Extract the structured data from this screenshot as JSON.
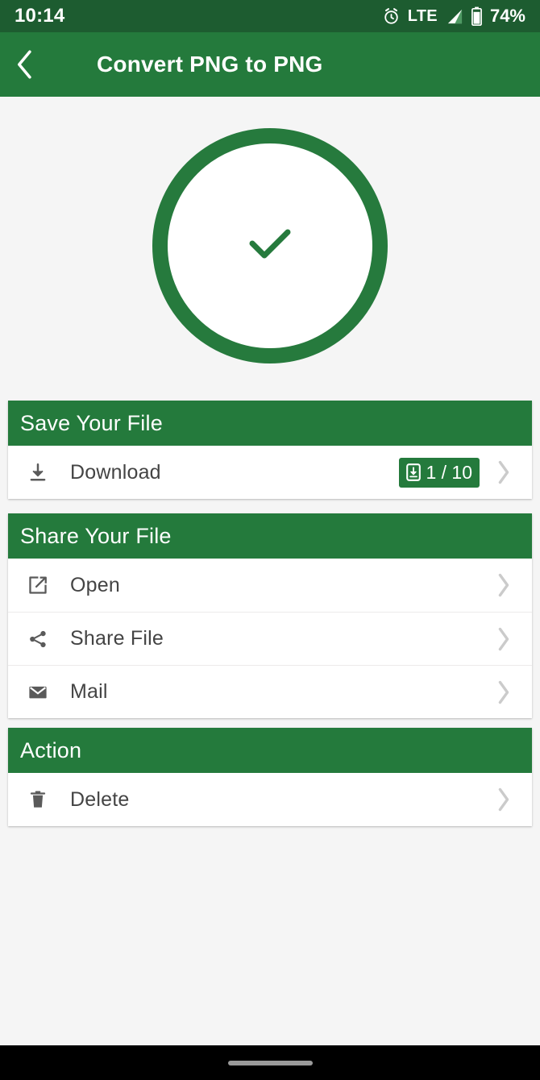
{
  "status_bar": {
    "time": "10:14",
    "network": "LTE",
    "battery_percent": "74%",
    "icons": [
      "alarm-clock-icon",
      "signal-bars-icon",
      "battery-icon"
    ],
    "background_color": "#1d5c30"
  },
  "app_bar": {
    "title": "Convert PNG to PNG",
    "back_icon": "chevron-left-icon",
    "background_color": "#247a3c"
  },
  "result": {
    "status_icon": "check-circle-icon",
    "accent_color": "#267a3d"
  },
  "sections": [
    {
      "id": "save",
      "title": "Save Your File",
      "rows": [
        {
          "label": "Download",
          "icon": "download-icon",
          "badge": "1 / 10",
          "badge_icon": "save-to-device-icon",
          "chevron": "chevron-right-icon"
        }
      ]
    },
    {
      "id": "share",
      "title": "Share Your File",
      "rows": [
        {
          "label": "Open",
          "icon": "external-link-icon",
          "chevron": "chevron-right-icon"
        },
        {
          "label": "Share File",
          "icon": "share-nodes-icon",
          "chevron": "chevron-right-icon"
        },
        {
          "label": "Mail",
          "icon": "envelope-icon",
          "chevron": "chevron-right-icon"
        }
      ]
    },
    {
      "id": "action",
      "title": "Action",
      "rows": [
        {
          "label": "Delete",
          "icon": "trash-icon",
          "chevron": "chevron-right-icon"
        }
      ]
    }
  ],
  "nav_bar": {
    "handle": "gesture-pill"
  },
  "colors": {
    "primary_green": "#247a3c",
    "dark_green": "#1d5c30",
    "page_background": "#f5f5f5",
    "text_gray": "#444444",
    "chevron_gray": "#cccccc"
  }
}
